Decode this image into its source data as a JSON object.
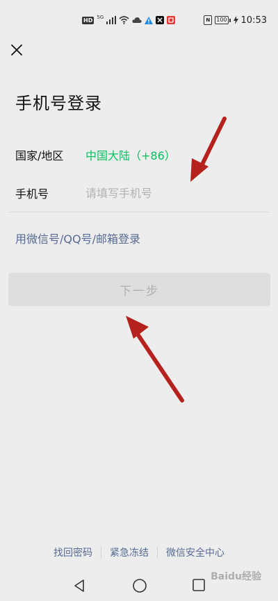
{
  "status_bar": {
    "hd_label": "HD",
    "signal_label": "5G",
    "battery_level": "100",
    "time": "10:53"
  },
  "header": {
    "title": "手机号登录"
  },
  "form": {
    "region_label": "国家/地区",
    "region_value": "中国大陆（+86）",
    "phone_label": "手机号",
    "phone_placeholder": "请填写手机号",
    "phone_value": ""
  },
  "alt_login_label": "用微信号/QQ号/邮箱登录",
  "next_button_label": "下一步",
  "footer": {
    "links": [
      "找回密码",
      "紧急冻结",
      "微信安全中心"
    ]
  },
  "watermark": "Baidu经验",
  "colors": {
    "background": "#ededed",
    "accent_green": "#07c160",
    "link_blue": "#576b95",
    "disabled_button": "#dedede",
    "annotation_arrow": "#b5211c"
  }
}
